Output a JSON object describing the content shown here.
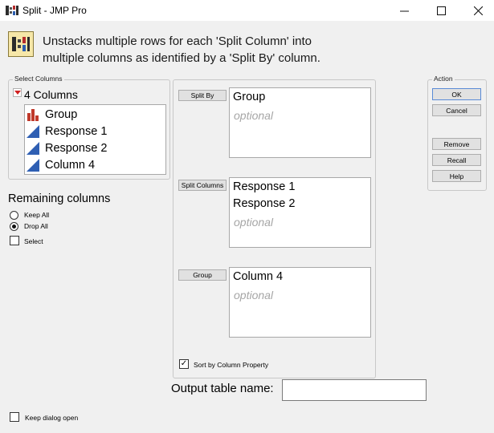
{
  "window": {
    "title": "Split - JMP Pro",
    "controls": [
      "minimize-icon",
      "maximize-icon",
      "close-icon"
    ]
  },
  "header": {
    "description_line1": "Unstacks multiple rows for each 'Split Column' into",
    "description_line2": "multiple columns as identified by a 'Split By' column."
  },
  "select_columns": {
    "label": "Select Columns",
    "count_label": "4 Columns",
    "items": [
      {
        "name": "Group",
        "icon": "nominal-bar-icon"
      },
      {
        "name": "Response 1",
        "icon": "continuous-triangle-icon"
      },
      {
        "name": "Response 2",
        "icon": "continuous-triangle-icon"
      },
      {
        "name": "Column 4",
        "icon": "continuous-triangle-icon"
      }
    ]
  },
  "remaining_columns": {
    "heading": "Remaining columns",
    "options": [
      "Keep All",
      "Drop All"
    ],
    "selected": "Drop All",
    "select_label": "Select"
  },
  "roles": {
    "split_by": {
      "button": "Split By",
      "items": [
        "Group"
      ],
      "optional": "optional"
    },
    "split_columns": {
      "button": "Split Columns",
      "items": [
        "Response 1",
        "Response 2"
      ],
      "optional": "optional"
    },
    "group": {
      "button": "Group",
      "items": [
        "Column 4"
      ],
      "optional": "optional"
    }
  },
  "sort_by_column_property": {
    "label": "Sort by Column Property",
    "checked": true
  },
  "output": {
    "label": "Output table name:",
    "value": ""
  },
  "action": {
    "label": "Action",
    "buttons": [
      "OK",
      "Cancel",
      "Remove",
      "Recall",
      "Help"
    ]
  },
  "keep_dialog_open": {
    "label": "Keep dialog open",
    "checked": false
  },
  "colors": {
    "accent_red": "#c0392b",
    "continuous_blue": "#2f5fb3",
    "ok_border": "#5a8bd6"
  }
}
